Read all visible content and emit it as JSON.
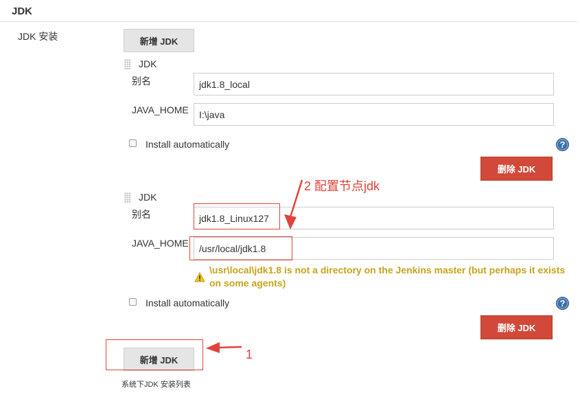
{
  "section": {
    "title": "JDK"
  },
  "jdk_install": {
    "label": "JDK 安装",
    "add_button_top": "新增 JDK",
    "add_button_bottom": "新增 JDK",
    "footnote": "系统下JDK 安装列表",
    "entries": [
      {
        "title": "JDK",
        "alias_label": "别名",
        "alias_value": "jdk1.8_local",
        "home_label": "JAVA_HOME",
        "home_value": "I:\\java",
        "install_auto_label": "Install automatically",
        "delete_label": "删除 JDK"
      },
      {
        "title": "JDK",
        "alias_label": "别名",
        "alias_value": "jdk1.8_Linux127",
        "home_label": "JAVA_HOME",
        "home_value": "/usr/local/jdk1.8",
        "warning": "\\usr\\local\\jdk1.8 is not a directory on the Jenkins master (but perhaps it exists on some agents)",
        "install_auto_label": "Install automatically",
        "delete_label": "删除 JDK"
      }
    ]
  },
  "annotations": {
    "note_2": "2 配置节点jdk",
    "note_1": "1"
  },
  "icons": {
    "help": "help-icon",
    "warning": "warning-icon",
    "grip": "drag-handle-icon"
  },
  "colors": {
    "delete": "#d24939",
    "warning": "#c7a31b",
    "annotation": "#e0433a",
    "help": "#3a6ea5"
  }
}
